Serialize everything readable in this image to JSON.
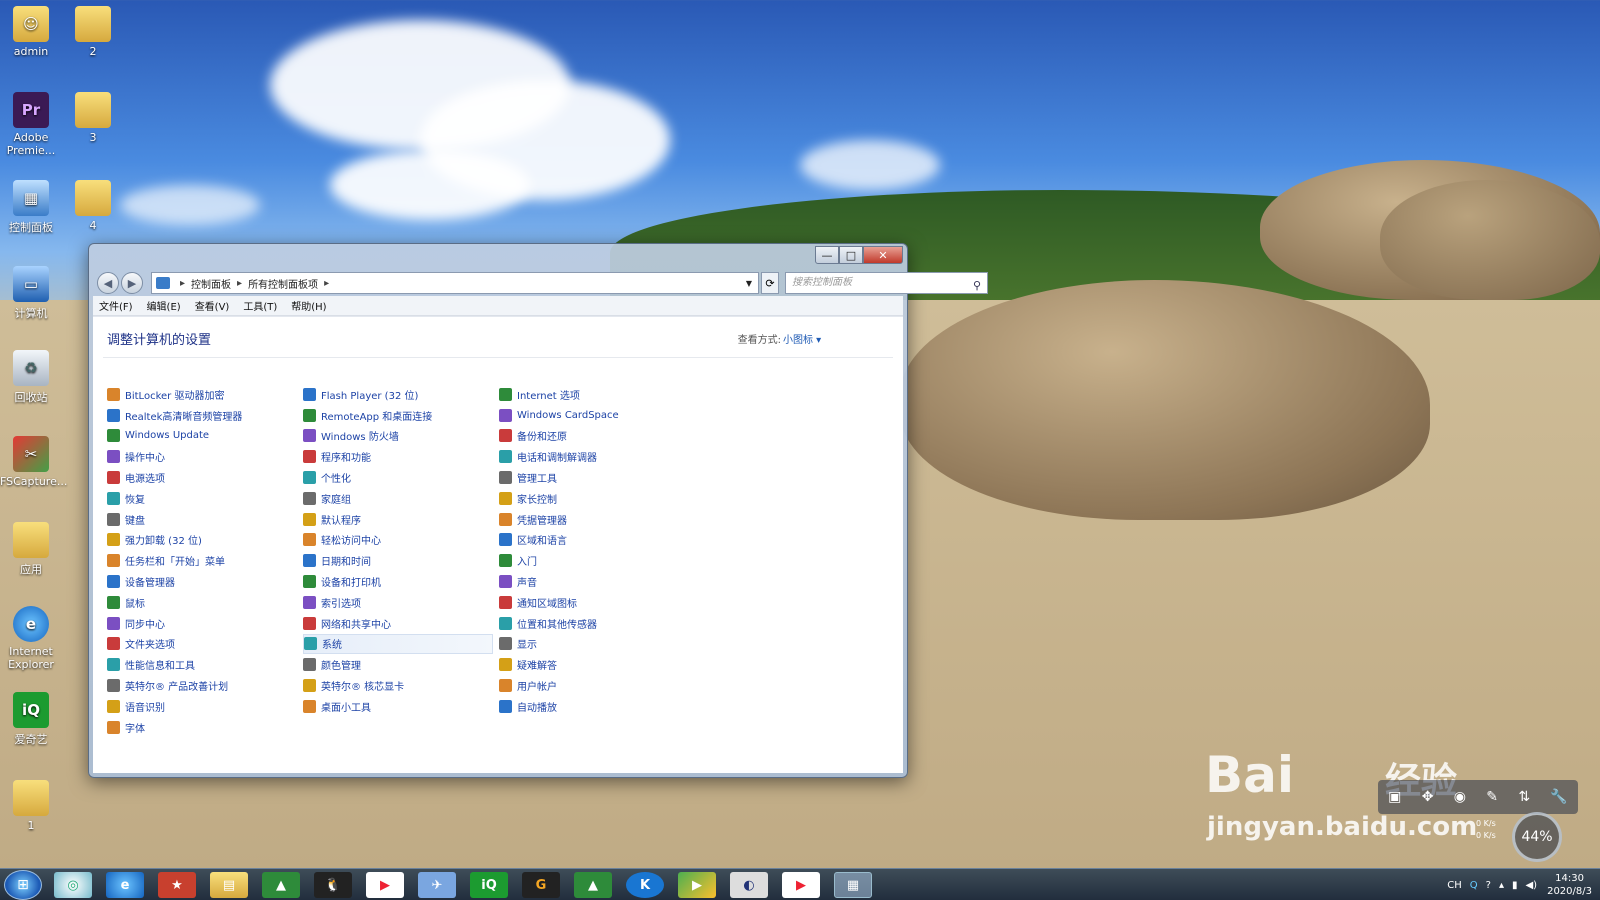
{
  "desktop": {
    "icons": [
      {
        "label": "admin"
      },
      {
        "label": "2"
      },
      {
        "label": "Adobe Premie..."
      },
      {
        "label": "3"
      },
      {
        "label": "控制面板"
      },
      {
        "label": "4"
      },
      {
        "label": "计算机"
      },
      {
        "label": "回收站"
      },
      {
        "label": "FSCapture..."
      },
      {
        "label": "应用"
      },
      {
        "label": "Internet Explorer"
      },
      {
        "label": "爱奇艺"
      },
      {
        "label": "1"
      }
    ]
  },
  "window": {
    "min_glyph": "—",
    "max_glyph": "□",
    "close_glyph": "✕",
    "back_glyph": "◀",
    "forward_glyph": "▶",
    "breadcrumb": [
      "控制面板",
      "所有控制面板项"
    ],
    "separator": "▸",
    "search_placeholder": "搜索控制面板",
    "menu": [
      "文件(F)",
      "编辑(E)",
      "查看(V)",
      "工具(T)",
      "帮助(H)"
    ],
    "heading": "调整计算机的设置",
    "view_by_label": "查看方式:",
    "view_by_value": "小图标 ▾",
    "columns": [
      [
        "BitLocker 驱动器加密",
        "Realtek高清晰音频管理器",
        "Windows Update",
        "操作中心",
        "电源选项",
        "恢复",
        "键盘",
        "强力卸载 (32 位)",
        "任务栏和「开始」菜单",
        "设备管理器",
        "鼠标",
        "同步中心",
        "文件夹选项",
        "性能信息和工具",
        "英特尔® 产品改善计划",
        "语音识别",
        "字体"
      ],
      [
        "Flash Player (32 位)",
        "RemoteApp 和桌面连接",
        "Windows 防火墙",
        "程序和功能",
        "个性化",
        "家庭组",
        "默认程序",
        "轻松访问中心",
        "日期和时间",
        "设备和打印机",
        "索引选项",
        "网络和共享中心",
        "系统",
        "颜色管理",
        "英特尔® 核芯显卡",
        "桌面小工具"
      ],
      [
        "Internet 选项",
        "Windows CardSpace",
        "备份和还原",
        "电话和调制解调器",
        "管理工具",
        "家长控制",
        "凭据管理器",
        "区域和语言",
        "入门",
        "声音",
        "通知区域图标",
        "位置和其他传感器",
        "显示",
        "疑难解答",
        "用户帐户",
        "自动播放"
      ]
    ],
    "selected_item": "系统"
  },
  "taskbar": {
    "apps": [
      "start",
      "browser-360",
      "ie",
      "app-red",
      "explorer",
      "green-app",
      "qq",
      "youku",
      "feige",
      "iqiyi",
      "g-app",
      "green-app-2",
      "kugou",
      "player",
      "search-app",
      "youku-2",
      "control-panel"
    ],
    "tray_lang": "CH",
    "time": "14:30",
    "date": "2020/8/3"
  },
  "gadget": {
    "net_up": "0 K/s",
    "net_down": "0 K/s",
    "percent": "44%"
  },
  "watermark": {
    "brand": "Bai",
    "brand2": "经验",
    "url": "jingyan.baidu.com"
  },
  "colors": {
    "link_blue": "#1d43a6",
    "heading_blue": "#1e3287"
  }
}
